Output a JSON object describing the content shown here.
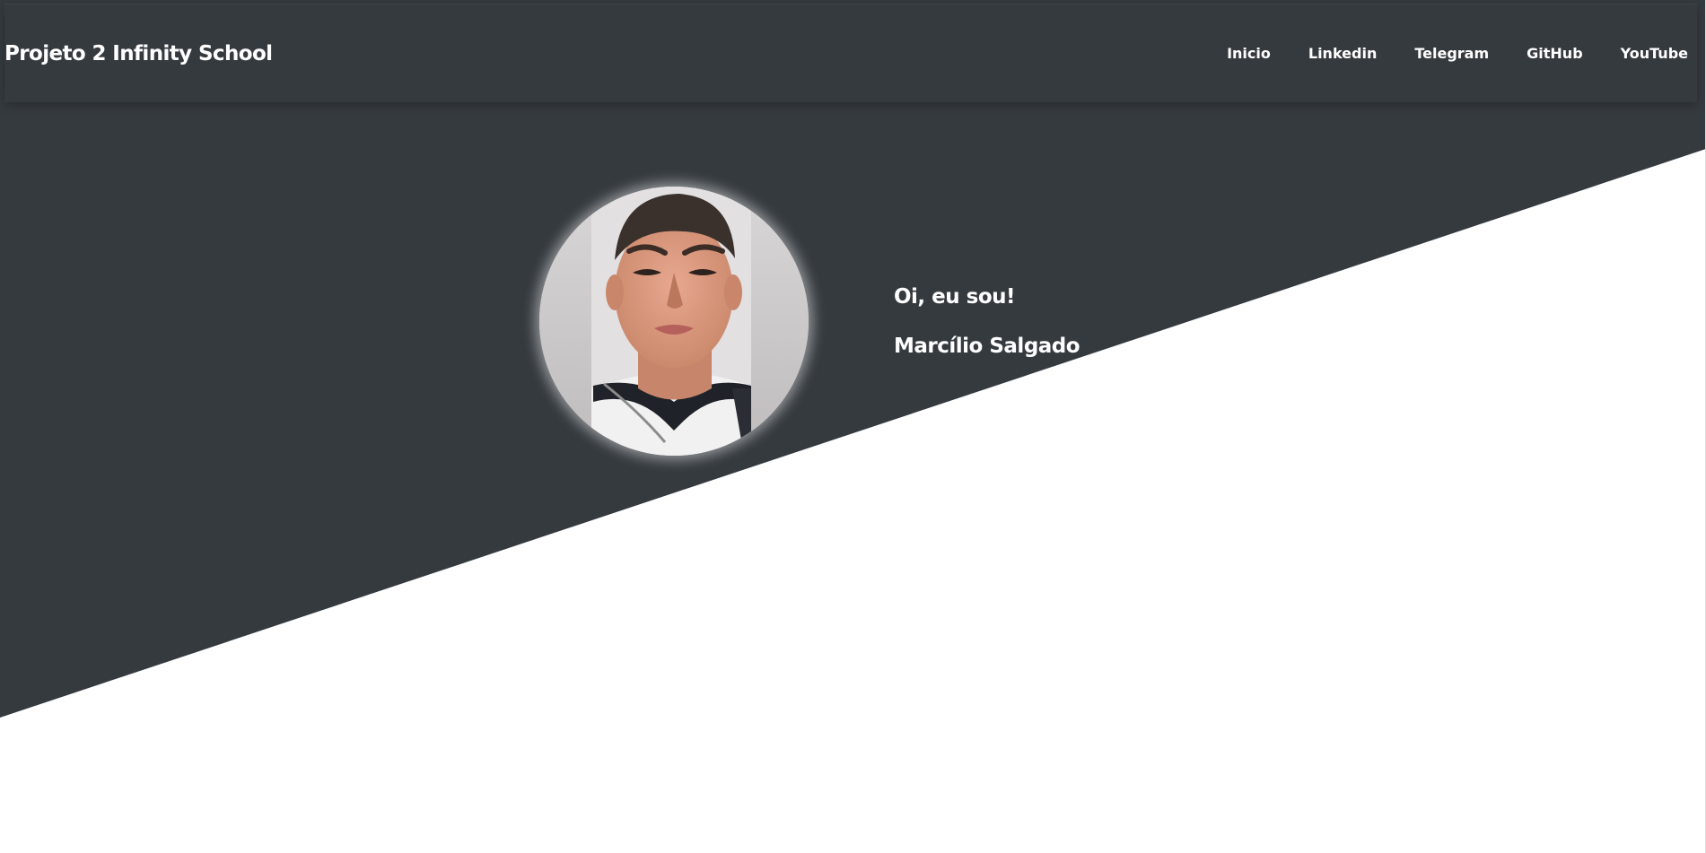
{
  "brand": {
    "title": "Projeto 2 Infinity School"
  },
  "nav": {
    "items": [
      {
        "label": "Inicio"
      },
      {
        "label": "Linkedin"
      },
      {
        "label": "Telegram"
      },
      {
        "label": "GitHub"
      },
      {
        "label": "YouTube"
      }
    ]
  },
  "hero": {
    "greeting": "Oi, eu sou!",
    "name": "Marcílio Salgado",
    "avatar_icon": "profile-photo"
  },
  "colors": {
    "dark": "#353a3f",
    "light": "#ffffff",
    "text": "#ffffff"
  }
}
